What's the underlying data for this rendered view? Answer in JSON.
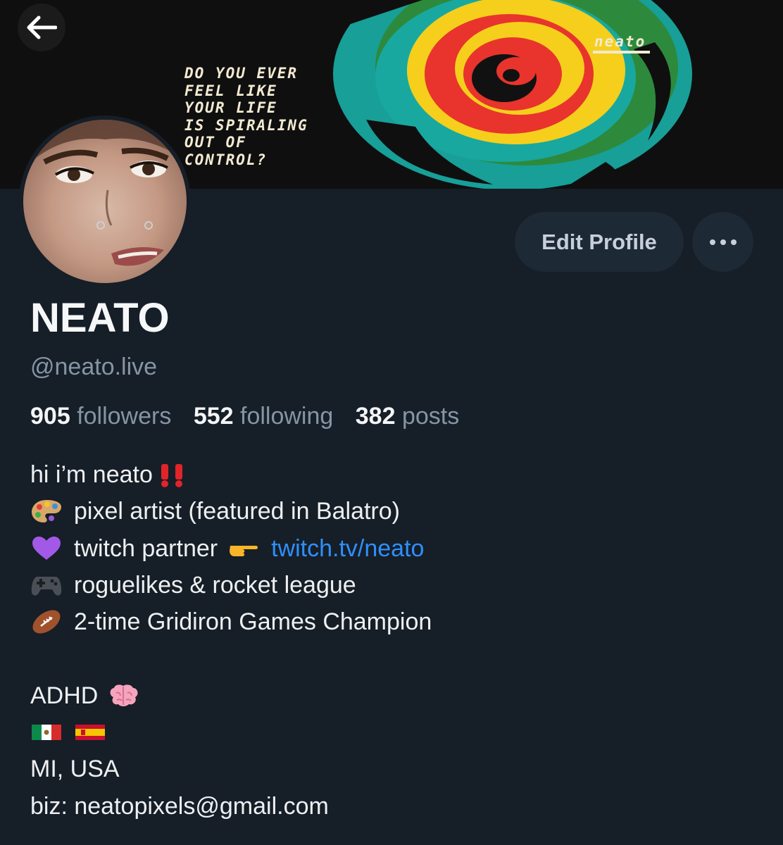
{
  "banner": {
    "text_lines": [
      "do you ever",
      "feel like",
      "your life",
      "is spiraling",
      "out of",
      "control?"
    ],
    "tag": "neato"
  },
  "profile": {
    "display_name": "NEATO",
    "handle": "@neato.live",
    "edit_label": "Edit Profile",
    "more_label": "•••"
  },
  "stats": [
    {
      "value": "905",
      "label": "followers"
    },
    {
      "value": "552",
      "label": "following"
    },
    {
      "value": "382",
      "label": "posts"
    }
  ],
  "bio": {
    "line1": "hi i’m neato",
    "line2": "pixel artist (featured in Balatro)",
    "line3_text": "twitch partner",
    "line3_link": "twitch.tv/neato",
    "line4": "roguelikes & rocket league",
    "line5": "2-time Gridiron Games Champion",
    "line6": "ADHD",
    "line8": "MI, USA",
    "line9": "biz: neatopixels@gmail.com"
  },
  "colors": {
    "background": "#161e27",
    "button": "#1e2936",
    "muted_text": "#8595a6",
    "link": "#2e8fff"
  }
}
